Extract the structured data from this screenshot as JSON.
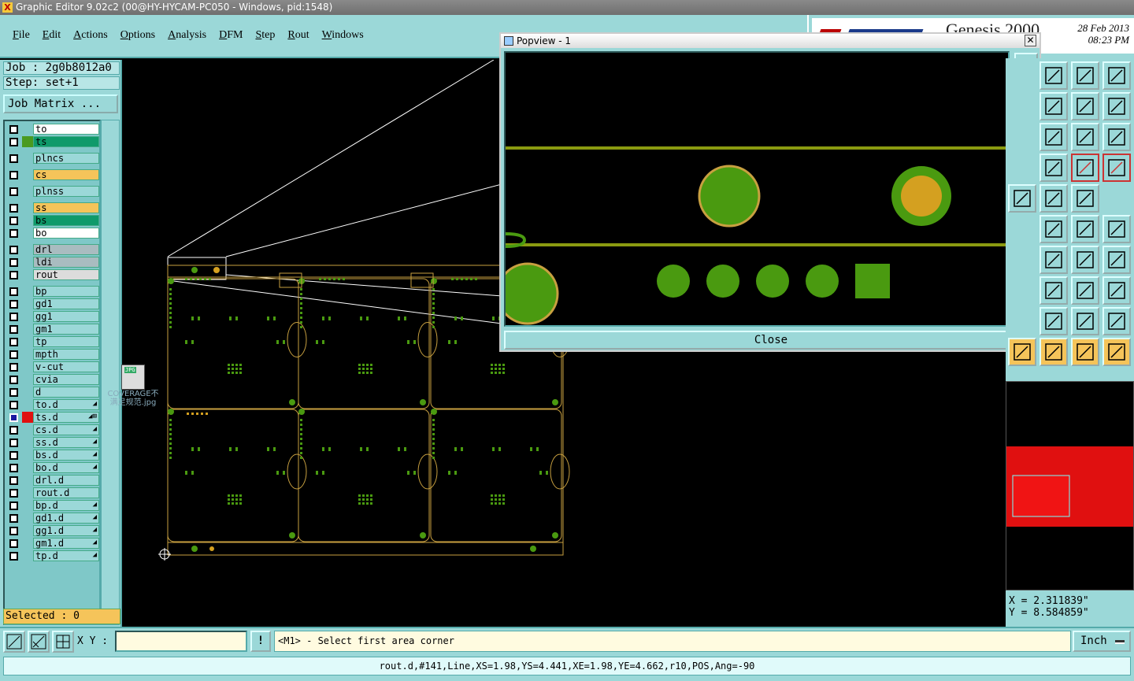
{
  "window": {
    "title": "Graphic Editor 9.02c2 (00@HY-HYCAM-PC050 - Windows, pid:1548)"
  },
  "menu": [
    {
      "label": "File"
    },
    {
      "label": "Edit"
    },
    {
      "label": "Actions"
    },
    {
      "label": "Options"
    },
    {
      "label": "Analysis"
    },
    {
      "label": "DFM"
    },
    {
      "label": "Step"
    },
    {
      "label": "Rout"
    },
    {
      "label": "Windows"
    }
  ],
  "header": {
    "product": "Genesis 2000",
    "date": "28 Feb 2013",
    "time": "08:23 PM"
  },
  "job": {
    "job_label": "Job : 2g0b8012a0",
    "step_label": "Step: set+1",
    "matrix_button": "Job Matrix ..."
  },
  "layers": [
    {
      "name": "to",
      "color": "#ffffff",
      "chip": ""
    },
    {
      "name": "ts",
      "color": "#0f9a6a",
      "chip": "#4a9a20"
    },
    {
      "name": "plncs",
      "color": "#9bd8d8",
      "chip": ""
    },
    {
      "name": "cs",
      "color": "#f5c45a",
      "chip": ""
    },
    {
      "name": "plnss",
      "color": "#9bd8d8",
      "chip": ""
    },
    {
      "name": "ss",
      "color": "#f5c45a",
      "chip": ""
    },
    {
      "name": "bs",
      "color": "#0f9a6a",
      "chip": ""
    },
    {
      "name": "bo",
      "color": "#ffffff",
      "chip": ""
    },
    {
      "name": "drl",
      "color": "#a9bcc0",
      "chip": ""
    },
    {
      "name": "ldi",
      "color": "#a9bcc0",
      "chip": ""
    },
    {
      "name": "rout",
      "color": "#dcdcdc",
      "chip": ""
    },
    {
      "name": "bp",
      "color": "#9bd8d8",
      "chip": ""
    },
    {
      "name": "gd1",
      "color": "#9bd8d8",
      "chip": ""
    },
    {
      "name": "gg1",
      "color": "#9bd8d8",
      "chip": ""
    },
    {
      "name": "gm1",
      "color": "#9bd8d8",
      "chip": ""
    },
    {
      "name": "tp",
      "color": "#9bd8d8",
      "chip": ""
    },
    {
      "name": "mpth",
      "color": "#9bd8d8",
      "chip": ""
    },
    {
      "name": "v-cut",
      "color": "#9bd8d8",
      "chip": ""
    },
    {
      "name": "cvia",
      "color": "#9bd8d8",
      "chip": ""
    },
    {
      "name": "d",
      "color": "#9bd8d8",
      "chip": ""
    },
    {
      "name": "to.d",
      "color": "#9bd8d8",
      "chip": "",
      "mark": "◢"
    },
    {
      "name": "ts.d",
      "color": "#9bd8d8",
      "chip": "#e01010",
      "mark": "◢⊞",
      "active": true
    },
    {
      "name": "cs.d",
      "color": "#9bd8d8",
      "chip": "",
      "mark": "◢"
    },
    {
      "name": "ss.d",
      "color": "#9bd8d8",
      "chip": "",
      "mark": "◢"
    },
    {
      "name": "bs.d",
      "color": "#9bd8d8",
      "chip": "",
      "mark": "◢"
    },
    {
      "name": "bo.d",
      "color": "#9bd8d8",
      "chip": "",
      "mark": "◢"
    },
    {
      "name": "drl.d",
      "color": "#9bd8d8",
      "chip": ""
    },
    {
      "name": "rout.d",
      "color": "#9bd8d8",
      "chip": ""
    },
    {
      "name": "bp.d",
      "color": "#9bd8d8",
      "chip": "",
      "mark": "◢"
    },
    {
      "name": "gd1.d",
      "color": "#9bd8d8",
      "chip": "",
      "mark": "◢"
    },
    {
      "name": "gg1.d",
      "color": "#9bd8d8",
      "chip": "",
      "mark": "◢"
    },
    {
      "name": "gm1.d",
      "color": "#9bd8d8",
      "chip": "",
      "mark": "◢"
    },
    {
      "name": "tp.d",
      "color": "#9bd8d8",
      "chip": "",
      "mark": "◢"
    }
  ],
  "selected": "Selected : 0",
  "desktop_icon": {
    "badge": "JPG",
    "label": "COVERAGE不满足规范.jpg"
  },
  "popview": {
    "title": "Popview - 1",
    "close_label": "Close"
  },
  "coords": {
    "x": "X = 2.311839\"",
    "y": "Y = 8.584859\""
  },
  "input": {
    "xy_label": "X Y :",
    "xy_value": "",
    "prompt": "<M1> - Select first area corner",
    "unit": "Inch"
  },
  "status": "rout.d,#141,Line,XS=1.98,YS=4.441,XE=1.98,YE=4.662,r10,POS,Ang=-90",
  "colors": {
    "panel": "#9bd8d8",
    "board_outline": "#c8a040",
    "pad_green": "#4a9a10",
    "pad_gold": "#d4a020",
    "overview_red": "#e01010"
  }
}
